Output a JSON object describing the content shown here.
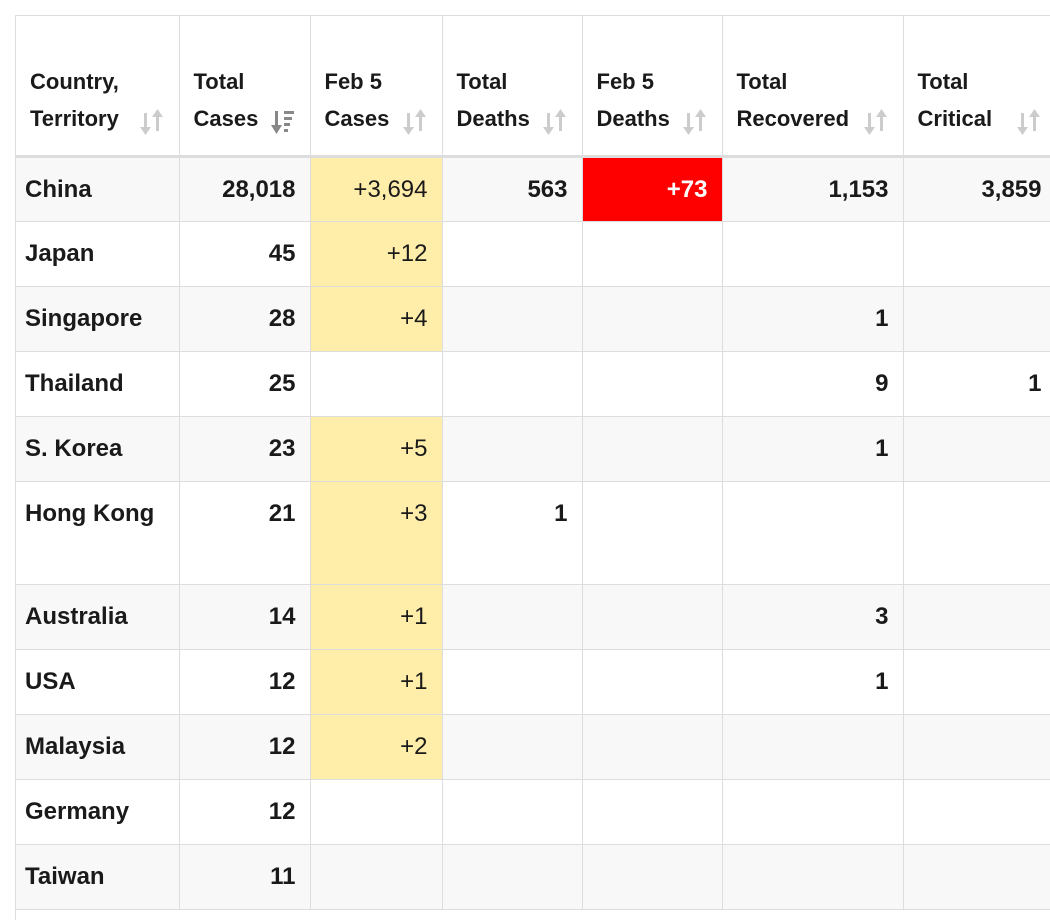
{
  "headers": [
    {
      "line1": "Country,",
      "line2": "Territory",
      "icon": "sort-icon"
    },
    {
      "line1": "Total",
      "line2": "Cases",
      "icon": "sort-desc-icon"
    },
    {
      "line1": "Feb 5",
      "line2": "Cases",
      "icon": "sort-icon"
    },
    {
      "line1": "Total",
      "line2": "Deaths",
      "icon": "sort-icon"
    },
    {
      "line1": "Feb 5",
      "line2": "Deaths",
      "icon": "sort-icon"
    },
    {
      "line1": "Total",
      "line2": "Recovered",
      "icon": "sort-icon"
    },
    {
      "line1": "Total",
      "line2": "Critical",
      "icon": "sort-icon"
    }
  ],
  "rows": [
    {
      "country": "China",
      "total_cases": "28,018",
      "new_cases": "+3,694",
      "total_deaths": "563",
      "new_deaths": "+73",
      "total_recovered": "1,153",
      "total_critical": "3,859"
    },
    {
      "country": "Japan",
      "total_cases": "45",
      "new_cases": "+12",
      "total_deaths": "",
      "new_deaths": "",
      "total_recovered": "",
      "total_critical": ""
    },
    {
      "country": "Singapore",
      "total_cases": "28",
      "new_cases": "+4",
      "total_deaths": "",
      "new_deaths": "",
      "total_recovered": "1",
      "total_critical": ""
    },
    {
      "country": "Thailand",
      "total_cases": "25",
      "new_cases": "",
      "total_deaths": "",
      "new_deaths": "",
      "total_recovered": "9",
      "total_critical": "1"
    },
    {
      "country": "S. Korea",
      "total_cases": "23",
      "new_cases": "+5",
      "total_deaths": "",
      "new_deaths": "",
      "total_recovered": "1",
      "total_critical": ""
    },
    {
      "country": "Hong Kong",
      "total_cases": "21",
      "new_cases": "+3",
      "total_deaths": "1",
      "new_deaths": "",
      "total_recovered": "",
      "total_critical": ""
    },
    {
      "country": "Australia",
      "total_cases": "14",
      "new_cases": "+1",
      "total_deaths": "",
      "new_deaths": "",
      "total_recovered": "3",
      "total_critical": ""
    },
    {
      "country": "USA",
      "total_cases": "12",
      "new_cases": "+1",
      "total_deaths": "",
      "new_deaths": "",
      "total_recovered": "1",
      "total_critical": ""
    },
    {
      "country": "Malaysia",
      "total_cases": "12",
      "new_cases": "+2",
      "total_deaths": "",
      "new_deaths": "",
      "total_recovered": "",
      "total_critical": ""
    },
    {
      "country": "Germany",
      "total_cases": "12",
      "new_cases": "",
      "total_deaths": "",
      "new_deaths": "",
      "total_recovered": "",
      "total_critical": ""
    },
    {
      "country": "Taiwan",
      "total_cases": "11",
      "new_cases": "",
      "total_deaths": "",
      "new_deaths": "",
      "total_recovered": "",
      "total_critical": ""
    }
  ],
  "colors": {
    "new_cases_highlight": "#ffeeaa",
    "new_deaths_highlight": "#ff0000",
    "sort_icon": "#cccccc",
    "sort_active": "#888888"
  }
}
